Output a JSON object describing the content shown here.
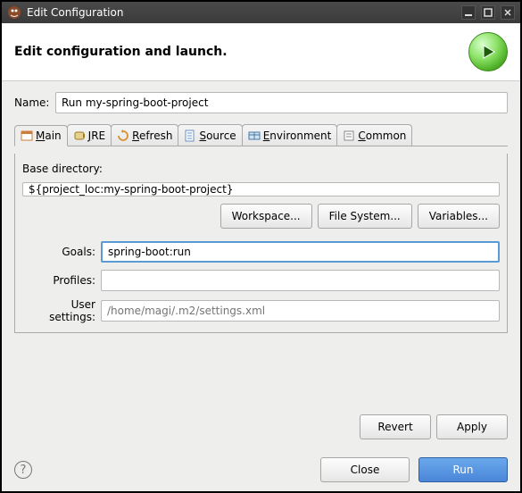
{
  "window": {
    "title": "Edit Configuration"
  },
  "header": {
    "title": "Edit configuration and launch."
  },
  "name": {
    "label": "Name:",
    "value": "Run my-spring-boot-project"
  },
  "tabs": [
    {
      "label": "Main",
      "mnemonic": "M",
      "rest": "ain"
    },
    {
      "label": "JRE",
      "mnemonic": "J",
      "rest": "RE"
    },
    {
      "label": "Refresh",
      "mnemonic": "R",
      "rest": "efresh"
    },
    {
      "label": "Source",
      "mnemonic": "S",
      "rest": "ource"
    },
    {
      "label": "Environment",
      "mnemonic": "E",
      "rest": "nvironment"
    },
    {
      "label": "Common",
      "mnemonic": "C",
      "rest": "ommon"
    }
  ],
  "main_tab": {
    "base_dir_label": "Base directory:",
    "base_dir_value": "${project_loc:my-spring-boot-project}",
    "buttons": {
      "workspace": "Workspace...",
      "fs": "File System...",
      "vars": "Variables..."
    },
    "goals_label": "Goals:",
    "goals_value": "spring-boot:run",
    "profiles_label": "Profiles:",
    "profiles_value": "",
    "user_settings_label": "User settings:",
    "user_settings_placeholder": "/home/magi/.m2/settings.xml"
  },
  "actions": {
    "revert": "Revert",
    "apply": "Apply"
  },
  "footer": {
    "close": "Close",
    "run": "Run"
  }
}
